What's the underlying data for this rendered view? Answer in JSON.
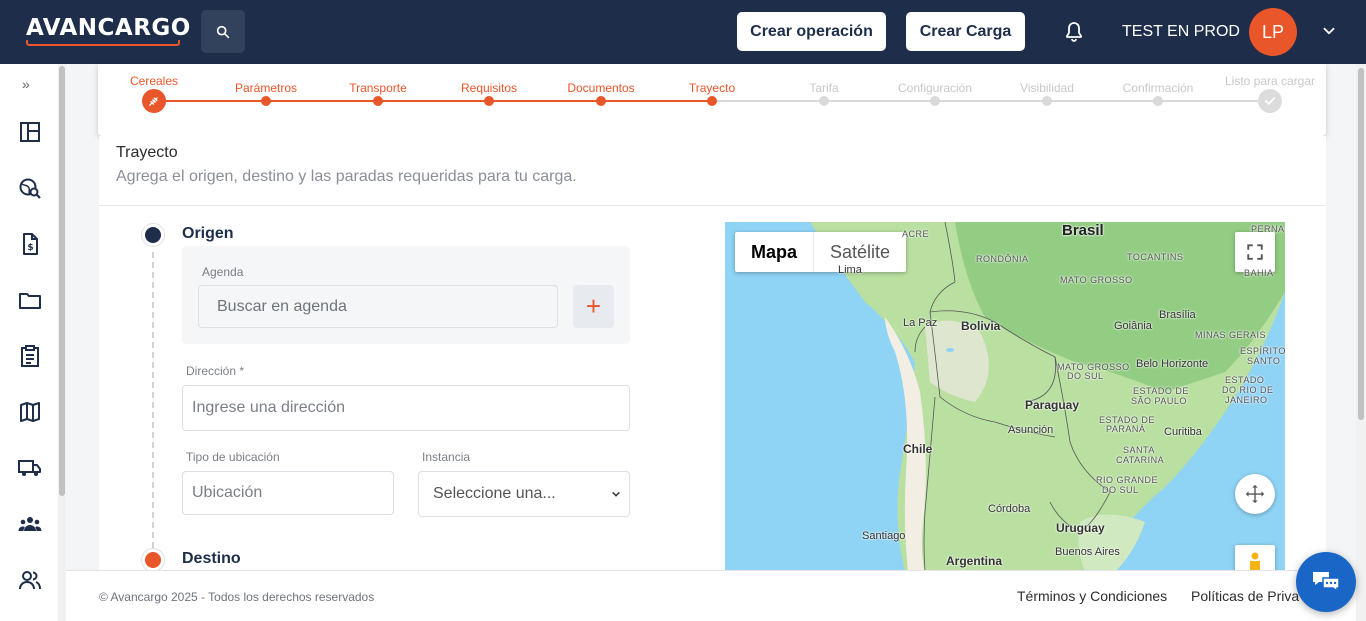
{
  "header": {
    "logo_text": "AVANCARGO",
    "create_operation_label": "Crear operación",
    "create_load_label": "Crear Carga",
    "user_name": "TEST EN PROD",
    "user_initials": "LP"
  },
  "sidebar": {
    "toggle_glyph": "»",
    "items": [
      {
        "icon": "dashboard-icon"
      },
      {
        "icon": "search-globe-icon"
      },
      {
        "icon": "invoice-icon"
      },
      {
        "icon": "folder-icon"
      },
      {
        "icon": "clipboard-icon"
      },
      {
        "icon": "map-icon"
      },
      {
        "icon": "truck-icon"
      },
      {
        "icon": "group-icon"
      },
      {
        "icon": "users-icon"
      }
    ]
  },
  "stepper": {
    "steps": [
      {
        "label": "Cereales",
        "state": "current"
      },
      {
        "label": "Parámetros",
        "state": "done"
      },
      {
        "label": "Transporte",
        "state": "done"
      },
      {
        "label": "Requisitos",
        "state": "done"
      },
      {
        "label": "Documentos",
        "state": "done"
      },
      {
        "label": "Trayecto",
        "state": "done"
      },
      {
        "label": "Tarifa",
        "state": "pending"
      },
      {
        "label": "Configuración",
        "state": "pending"
      },
      {
        "label": "Visibilidad",
        "state": "pending"
      },
      {
        "label": "Confirmación",
        "state": "pending"
      },
      {
        "label": "Listo para cargar",
        "state": "pending"
      }
    ],
    "accent": "#e8562a",
    "pending_color": "#d9d9d9"
  },
  "section": {
    "title": "Trayecto",
    "subtitle": "Agrega el origen, destino y las paradas requeridas para tu carga."
  },
  "origin": {
    "title": "Origen",
    "agenda_label": "Agenda",
    "agenda_placeholder": "Buscar en agenda",
    "add_glyph": "+",
    "address_label": "Dirección *",
    "address_placeholder": "Ingrese una dirección",
    "location_type_label": "Tipo de ubicación",
    "location_type_placeholder": "Ubicación",
    "instance_label": "Instancia",
    "instance_selected": "Seleccione una..."
  },
  "destination": {
    "title": "Destino"
  },
  "map": {
    "tab_map": "Mapa",
    "tab_satellite": "Satélite",
    "labels": {
      "acre": "ACRE",
      "brasil": "Brasil",
      "pernambuco": "PERNA",
      "rondonia": "RONDÔNIA",
      "tocantins": "TOCANTINS",
      "bahia": "BAHIA",
      "lima": "Lima",
      "mato_grosso": "MATO GROSSO",
      "la_paz": "La Paz",
      "bolivia": "Bolivia",
      "brasilia": "Brasília",
      "goiania": "Goiânia",
      "minas_gerais": "MINAS GERAIS",
      "espirito_santo_1": "ESPÍRITO",
      "espirito_santo_2": "SANTO",
      "mato_grosso_sul_1": "MATO GROSSO",
      "mato_grosso_sul_2": "DO SUL",
      "belo_horizonte": "Belo Horizonte",
      "sao_paulo_1": "ESTADO DE",
      "sao_paulo_2": "SÃO PAULO",
      "rio_1": "ESTADO",
      "rio_2": "DO RIO DE",
      "rio_3": "JANEIRO",
      "paraguay": "Paraguay",
      "parana_1": "ESTADO DE",
      "parana_2": "PARANÁ",
      "asuncion": "Asunción",
      "curitiba": "Curitiba",
      "chile": "Chile",
      "santa_catarina_1": "SANTA",
      "santa_catarina_2": "CATARINA",
      "rio_grande_1": "RIO GRANDE",
      "rio_grande_2": "DO SUL",
      "cordoba": "Córdoba",
      "uruguay": "Uruguay",
      "santiago": "Santiago",
      "buenos_aires": "Buenos Aires",
      "argentina": "Argentina"
    }
  },
  "footer": {
    "copyright": "© Avancargo 2025 - Todos los derechos reservados",
    "terms": "Términos y Condiciones",
    "privacy": "Políticas de Privacidad"
  }
}
